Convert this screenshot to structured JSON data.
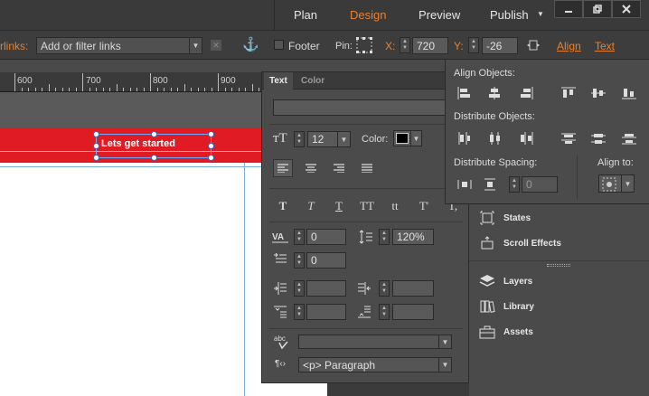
{
  "header": {
    "nav": [
      "Plan",
      "Design",
      "Preview",
      "Publish"
    ],
    "active_nav": "Design",
    "publish_arrow": "▼",
    "window_controls": [
      "minimize",
      "restore",
      "close"
    ],
    "colors": {
      "accent": "#e8802e",
      "bar": "#3a3a3a"
    }
  },
  "toolbar": {
    "links_label": "rlinks:",
    "links_placeholder": "Add or filter links",
    "footer_label": "Footer",
    "pin_label": "Pin:",
    "x_label": "X:",
    "x_value": "720",
    "y_label": "Y:",
    "y_value": "-26",
    "align_label": "Align",
    "text_label": "Text"
  },
  "ruler": {
    "ticks": [
      "600",
      "700",
      "800",
      "900"
    ]
  },
  "canvas": {
    "banner_text": "Lets get started",
    "banner_color": "#e01b24"
  },
  "text_panel": {
    "tabs": [
      "Text",
      "Color"
    ],
    "active_tab": "Text",
    "font_size": "12",
    "color_label": "Color:",
    "style_buttons": [
      "T",
      "T",
      "T",
      "TT",
      "tt",
      "T'",
      "T,"
    ],
    "char_spacing": "0",
    "line_height": "120%",
    "indent_first": "0",
    "paragraph_style": "<p> Paragraph"
  },
  "align_panel": {
    "align_objects_title": "Align Objects:",
    "distribute_objects_title": "Distribute Objects:",
    "distribute_spacing_title": "Distribute Spacing:",
    "spacing_value": "0",
    "align_to_title": "Align to:"
  },
  "right_panels": {
    "items": [
      "States",
      "Scroll Effects",
      "Layers",
      "Library",
      "Assets"
    ]
  }
}
